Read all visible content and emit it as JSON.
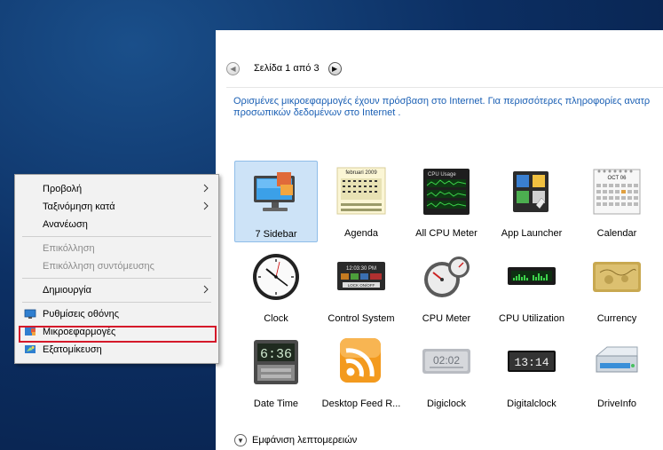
{
  "gallery": {
    "pager_text": "Σελίδα 1 από 3",
    "info_line1": "Ορισμένες μικροεφαρμογές έχουν πρόσβαση στο Internet.  Για περισσότερες πληροφορίες ανατρ",
    "info_line2": "προσωπικών δεδομένων στο Internet .",
    "gadgets": [
      {
        "name": "7 Sidebar",
        "icon": "sidebar-monitor-icon",
        "selected": true
      },
      {
        "name": "Agenda",
        "icon": "agenda-calendar-icon",
        "selected": false
      },
      {
        "name": "All CPU Meter",
        "icon": "cpu-graph-icon",
        "selected": false
      },
      {
        "name": "App Launcher",
        "icon": "app-launcher-icon",
        "selected": false
      },
      {
        "name": "Calendar",
        "icon": "calendar-icon",
        "selected": false
      },
      {
        "name": "Clock",
        "icon": "clock-icon",
        "selected": false
      },
      {
        "name": "Control System",
        "icon": "control-system-icon",
        "selected": false
      },
      {
        "name": "CPU Meter",
        "icon": "cpu-gauge-icon",
        "selected": false
      },
      {
        "name": "CPU Utilization",
        "icon": "cpu-utilization-icon",
        "selected": false
      },
      {
        "name": "Currency",
        "icon": "currency-card-icon",
        "selected": false
      },
      {
        "name": "Date Time",
        "icon": "date-time-icon",
        "selected": false
      },
      {
        "name": "Desktop Feed R...",
        "icon": "rss-feed-icon",
        "selected": false
      },
      {
        "name": "Digiclock",
        "icon": "digiclock-icon",
        "selected": false
      },
      {
        "name": "Digitalclock",
        "icon": "digitalclock-icon",
        "selected": false
      },
      {
        "name": "DriveInfo",
        "icon": "drive-info-icon",
        "selected": false
      }
    ],
    "details_label": "Εμφάνιση λεπτομερειών"
  },
  "thumb_text": {
    "agenda_header": "februari 2009",
    "cpu_usage": "CPU Usage",
    "control_time": "12:03:30 PM",
    "control_lock": "LOCK ON/OFF",
    "date_time": "6:36",
    "digiclock": "02:02",
    "digitalclock": "13:14",
    "calendar_month": "OCT 06"
  },
  "context_menu": {
    "view": "Προβολή",
    "sort_by": "Ταξινόμηση κατά",
    "refresh": "Ανανέωση",
    "paste": "Επικόλληση",
    "paste_shortcut": "Επικόλληση συντόμευσης",
    "new": "Δημιουργία",
    "display_settings": "Ρυθμίσεις οθόνης",
    "gadgets": "Μικροεφαρμογές",
    "personalize": "Εξατομίκευση"
  },
  "colors": {
    "highlight_border": "#d5192a",
    "link_text": "#1a5fb4",
    "selection_fill": "#cde3f7"
  }
}
